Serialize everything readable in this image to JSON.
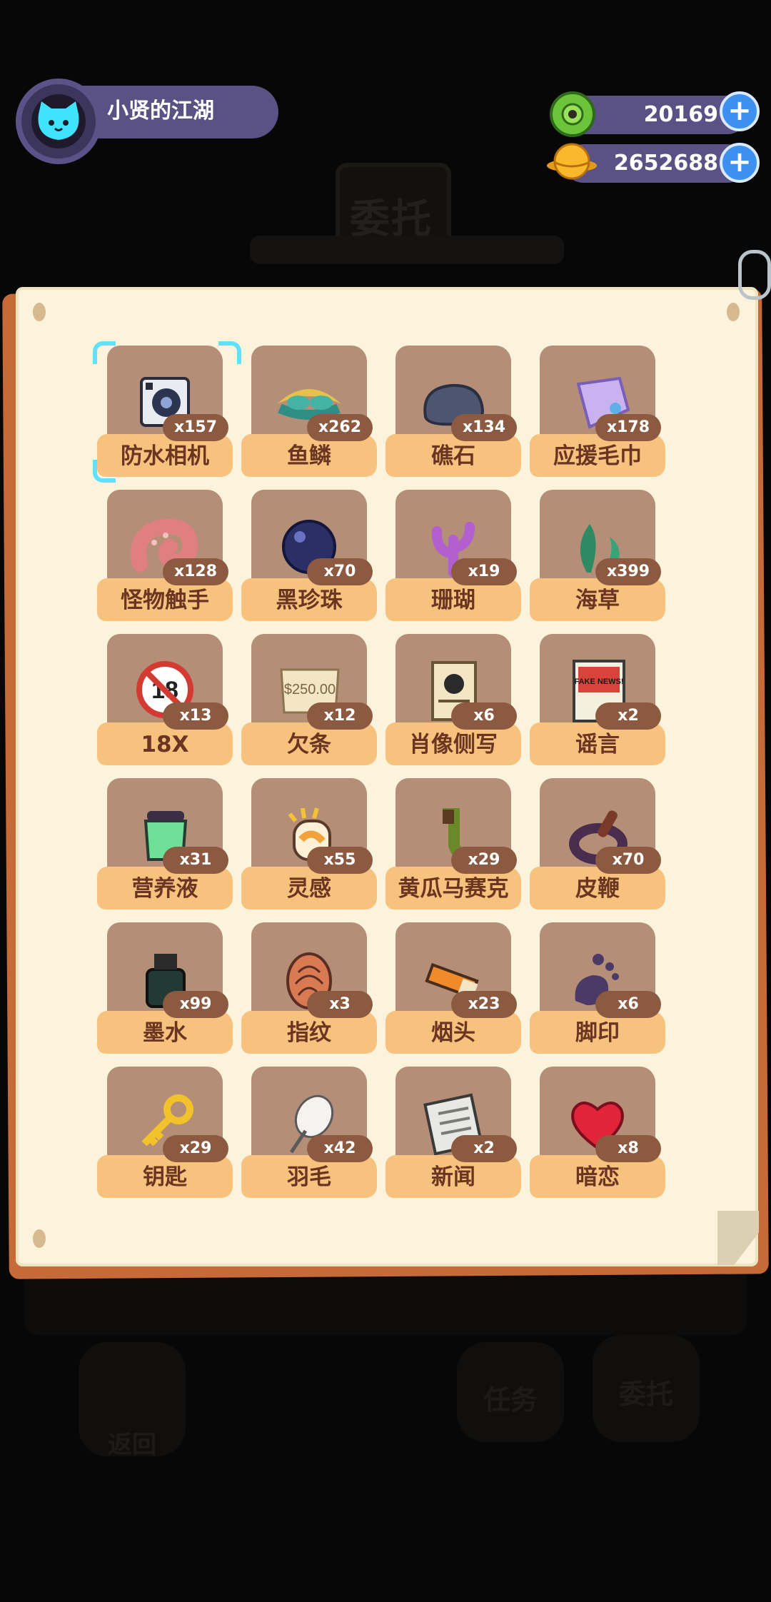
{
  "profile": {
    "name": "小贤的江湖"
  },
  "currency": {
    "gems": "20169",
    "coins": "2652688",
    "plus": "+"
  },
  "background": {
    "sign": "委托",
    "return_label": "返回",
    "task_label": "任务",
    "commission_label": "委托"
  },
  "inventory": {
    "items": [
      {
        "name": "防水相机",
        "count": "x157",
        "icon": "camera-icon"
      },
      {
        "name": "鱼鳞",
        "count": "x262",
        "icon": "fish-scale-icon"
      },
      {
        "name": "礁石",
        "count": "x134",
        "icon": "rock-icon"
      },
      {
        "name": "应援毛巾",
        "count": "x178",
        "icon": "towel-icon"
      },
      {
        "name": "怪物触手",
        "count": "x128",
        "icon": "tentacle-icon"
      },
      {
        "name": "黑珍珠",
        "count": "x70",
        "icon": "black-pearl-icon"
      },
      {
        "name": "珊瑚",
        "count": "x19",
        "icon": "coral-icon"
      },
      {
        "name": "海草",
        "count": "x399",
        "icon": "seaweed-icon"
      },
      {
        "name": "18X",
        "count": "x13",
        "icon": "no-18-icon"
      },
      {
        "name": "欠条",
        "count": "x12",
        "icon": "iou-note-icon"
      },
      {
        "name": "肖像侧写",
        "count": "x6",
        "icon": "portrait-icon"
      },
      {
        "name": "谣言",
        "count": "x2",
        "icon": "fake-news-icon"
      },
      {
        "name": "营养液",
        "count": "x31",
        "icon": "nutrient-jar-icon"
      },
      {
        "name": "灵感",
        "count": "x55",
        "icon": "inspiration-icon"
      },
      {
        "name": "黄瓜马赛克",
        "count": "x29",
        "icon": "cucumber-icon"
      },
      {
        "name": "皮鞭",
        "count": "x70",
        "icon": "whip-icon"
      },
      {
        "name": "墨水",
        "count": "x99",
        "icon": "ink-bottle-icon"
      },
      {
        "name": "指纹",
        "count": "x3",
        "icon": "fingerprint-icon"
      },
      {
        "name": "烟头",
        "count": "x23",
        "icon": "cigarette-butt-icon"
      },
      {
        "name": "脚印",
        "count": "x6",
        "icon": "footprint-icon"
      },
      {
        "name": "钥匙",
        "count": "x29",
        "icon": "key-icon"
      },
      {
        "name": "羽毛",
        "count": "x42",
        "icon": "feather-icon"
      },
      {
        "name": "新闻",
        "count": "x2",
        "icon": "newspaper-icon"
      },
      {
        "name": "暗恋",
        "count": "x8",
        "icon": "heart-icon"
      }
    ],
    "selected_index": 0,
    "news_sign": "FAKE NEWS!",
    "iou_amount": "$250.00"
  }
}
